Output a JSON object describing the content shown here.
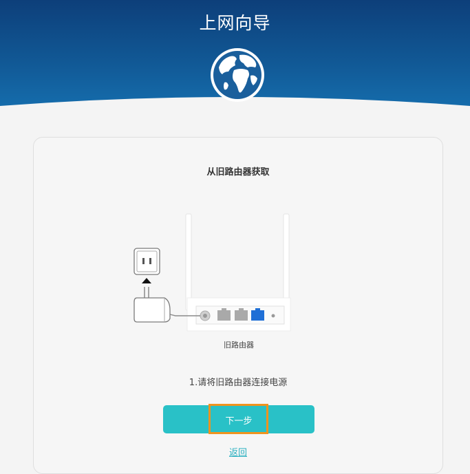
{
  "header": {
    "title": "上网向导",
    "background": "#115996"
  },
  "card": {
    "title": "从旧路由器获取",
    "device_caption": "旧路由器",
    "step_text": "1.请将旧路由器连接电源"
  },
  "actions": {
    "next_label": "下一步",
    "back_label": "返回",
    "button_color": "#29c1c7",
    "highlight_color": "#f0931e",
    "link_color": "#2ab0c0"
  },
  "icons": [
    "globe-icon",
    "power-socket-icon",
    "up-arrow-icon",
    "power-adapter-icon",
    "router-icon"
  ]
}
